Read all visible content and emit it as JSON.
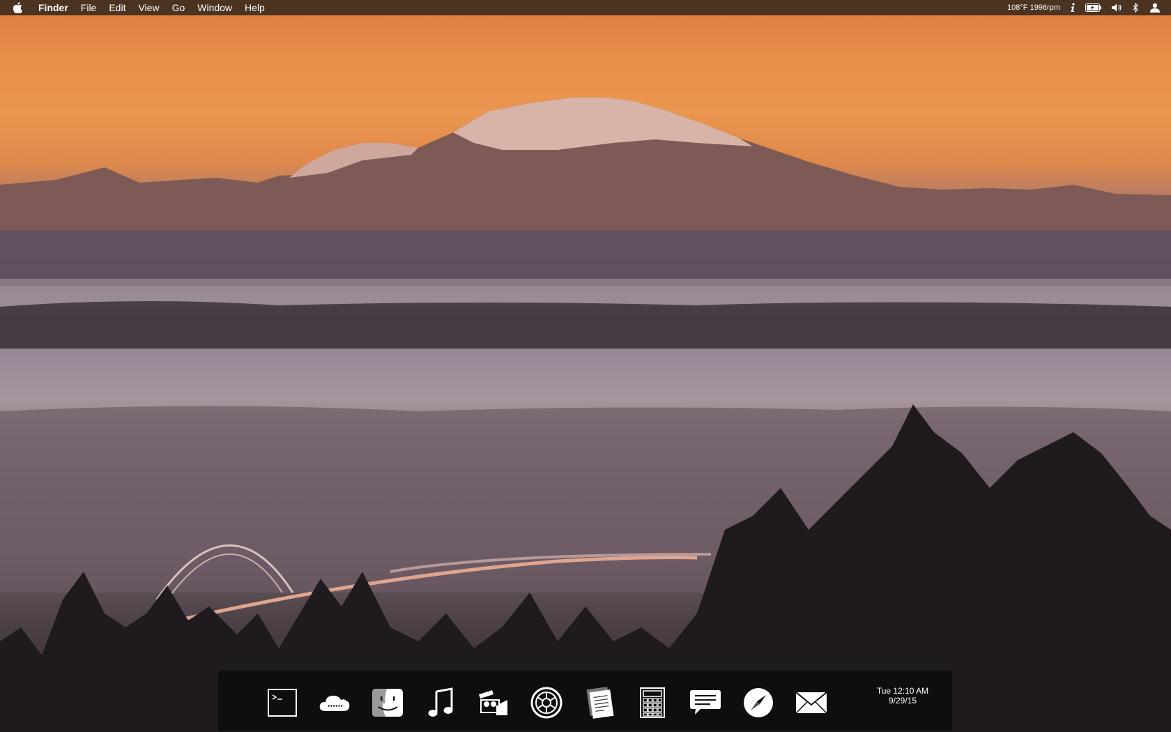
{
  "menubar": {
    "active_app": "Finder",
    "menus": [
      "File",
      "Edit",
      "View",
      "Go",
      "Window",
      "Help"
    ],
    "status_text": "108°F 1996rpm",
    "status_icons": [
      "info-icon",
      "battery-charging-icon",
      "volume-icon",
      "bluetooth-icon",
      "user-icon"
    ]
  },
  "dock": {
    "apps": [
      {
        "name": "Terminal",
        "icon": "terminal-icon"
      },
      {
        "name": "iCloud",
        "icon": "cloud-icon"
      },
      {
        "name": "Finder",
        "icon": "finder-icon"
      },
      {
        "name": "Music",
        "icon": "music-note-icon"
      },
      {
        "name": "Video",
        "icon": "video-camera-icon"
      },
      {
        "name": "Camera",
        "icon": "aperture-icon"
      },
      {
        "name": "Documents",
        "icon": "document-icon"
      },
      {
        "name": "Calculator",
        "icon": "calculator-icon"
      },
      {
        "name": "Messages",
        "icon": "chat-bubble-icon"
      },
      {
        "name": "Safari",
        "icon": "compass-icon"
      },
      {
        "name": "Mail",
        "icon": "mail-icon"
      }
    ],
    "clock": {
      "time": "Tue 12:10 AM",
      "date": "9/29/15"
    }
  },
  "colors": {
    "menubar_bg": "#4a3320",
    "dock_bg": "#0c0c0e"
  }
}
